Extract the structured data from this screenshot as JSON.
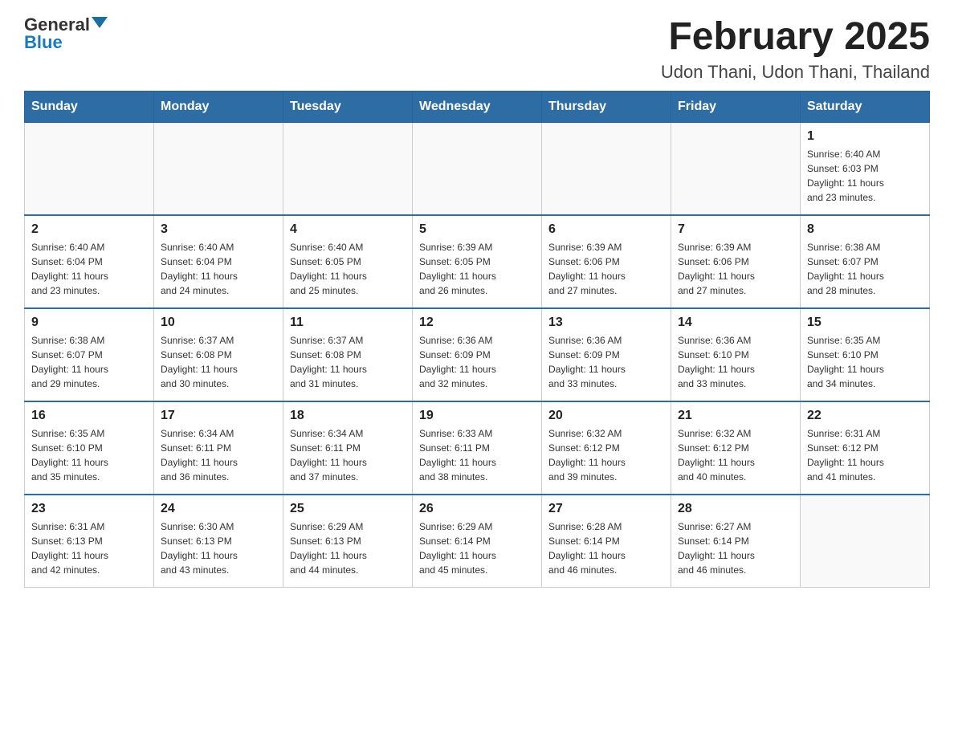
{
  "logo": {
    "general": "General",
    "blue": "Blue"
  },
  "title": "February 2025",
  "subtitle": "Udon Thani, Udon Thani, Thailand",
  "weekdays": [
    "Sunday",
    "Monday",
    "Tuesday",
    "Wednesday",
    "Thursday",
    "Friday",
    "Saturday"
  ],
  "weeks": [
    [
      {
        "day": "",
        "info": ""
      },
      {
        "day": "",
        "info": ""
      },
      {
        "day": "",
        "info": ""
      },
      {
        "day": "",
        "info": ""
      },
      {
        "day": "",
        "info": ""
      },
      {
        "day": "",
        "info": ""
      },
      {
        "day": "1",
        "info": "Sunrise: 6:40 AM\nSunset: 6:03 PM\nDaylight: 11 hours\nand 23 minutes."
      }
    ],
    [
      {
        "day": "2",
        "info": "Sunrise: 6:40 AM\nSunset: 6:04 PM\nDaylight: 11 hours\nand 23 minutes."
      },
      {
        "day": "3",
        "info": "Sunrise: 6:40 AM\nSunset: 6:04 PM\nDaylight: 11 hours\nand 24 minutes."
      },
      {
        "day": "4",
        "info": "Sunrise: 6:40 AM\nSunset: 6:05 PM\nDaylight: 11 hours\nand 25 minutes."
      },
      {
        "day": "5",
        "info": "Sunrise: 6:39 AM\nSunset: 6:05 PM\nDaylight: 11 hours\nand 26 minutes."
      },
      {
        "day": "6",
        "info": "Sunrise: 6:39 AM\nSunset: 6:06 PM\nDaylight: 11 hours\nand 27 minutes."
      },
      {
        "day": "7",
        "info": "Sunrise: 6:39 AM\nSunset: 6:06 PM\nDaylight: 11 hours\nand 27 minutes."
      },
      {
        "day": "8",
        "info": "Sunrise: 6:38 AM\nSunset: 6:07 PM\nDaylight: 11 hours\nand 28 minutes."
      }
    ],
    [
      {
        "day": "9",
        "info": "Sunrise: 6:38 AM\nSunset: 6:07 PM\nDaylight: 11 hours\nand 29 minutes."
      },
      {
        "day": "10",
        "info": "Sunrise: 6:37 AM\nSunset: 6:08 PM\nDaylight: 11 hours\nand 30 minutes."
      },
      {
        "day": "11",
        "info": "Sunrise: 6:37 AM\nSunset: 6:08 PM\nDaylight: 11 hours\nand 31 minutes."
      },
      {
        "day": "12",
        "info": "Sunrise: 6:36 AM\nSunset: 6:09 PM\nDaylight: 11 hours\nand 32 minutes."
      },
      {
        "day": "13",
        "info": "Sunrise: 6:36 AM\nSunset: 6:09 PM\nDaylight: 11 hours\nand 33 minutes."
      },
      {
        "day": "14",
        "info": "Sunrise: 6:36 AM\nSunset: 6:10 PM\nDaylight: 11 hours\nand 33 minutes."
      },
      {
        "day": "15",
        "info": "Sunrise: 6:35 AM\nSunset: 6:10 PM\nDaylight: 11 hours\nand 34 minutes."
      }
    ],
    [
      {
        "day": "16",
        "info": "Sunrise: 6:35 AM\nSunset: 6:10 PM\nDaylight: 11 hours\nand 35 minutes."
      },
      {
        "day": "17",
        "info": "Sunrise: 6:34 AM\nSunset: 6:11 PM\nDaylight: 11 hours\nand 36 minutes."
      },
      {
        "day": "18",
        "info": "Sunrise: 6:34 AM\nSunset: 6:11 PM\nDaylight: 11 hours\nand 37 minutes."
      },
      {
        "day": "19",
        "info": "Sunrise: 6:33 AM\nSunset: 6:11 PM\nDaylight: 11 hours\nand 38 minutes."
      },
      {
        "day": "20",
        "info": "Sunrise: 6:32 AM\nSunset: 6:12 PM\nDaylight: 11 hours\nand 39 minutes."
      },
      {
        "day": "21",
        "info": "Sunrise: 6:32 AM\nSunset: 6:12 PM\nDaylight: 11 hours\nand 40 minutes."
      },
      {
        "day": "22",
        "info": "Sunrise: 6:31 AM\nSunset: 6:12 PM\nDaylight: 11 hours\nand 41 minutes."
      }
    ],
    [
      {
        "day": "23",
        "info": "Sunrise: 6:31 AM\nSunset: 6:13 PM\nDaylight: 11 hours\nand 42 minutes."
      },
      {
        "day": "24",
        "info": "Sunrise: 6:30 AM\nSunset: 6:13 PM\nDaylight: 11 hours\nand 43 minutes."
      },
      {
        "day": "25",
        "info": "Sunrise: 6:29 AM\nSunset: 6:13 PM\nDaylight: 11 hours\nand 44 minutes."
      },
      {
        "day": "26",
        "info": "Sunrise: 6:29 AM\nSunset: 6:14 PM\nDaylight: 11 hours\nand 45 minutes."
      },
      {
        "day": "27",
        "info": "Sunrise: 6:28 AM\nSunset: 6:14 PM\nDaylight: 11 hours\nand 46 minutes."
      },
      {
        "day": "28",
        "info": "Sunrise: 6:27 AM\nSunset: 6:14 PM\nDaylight: 11 hours\nand 46 minutes."
      },
      {
        "day": "",
        "info": ""
      }
    ]
  ]
}
